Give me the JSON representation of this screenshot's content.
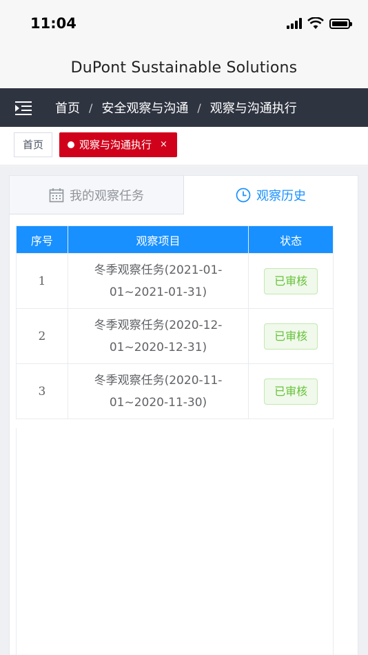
{
  "status_bar": {
    "time": "11:04"
  },
  "app": {
    "title": "DuPont Sustainable Solutions"
  },
  "breadcrumb": {
    "items": [
      "首页",
      "安全观察与沟通",
      "观察与沟通执行"
    ],
    "separator": "/"
  },
  "tags": {
    "home": "首页",
    "active": "观察与沟通执行",
    "close": "×"
  },
  "tabs": [
    {
      "label": "我的观察任务",
      "icon": "calendar-icon",
      "active": false
    },
    {
      "label": "观察历史",
      "icon": "clock-icon",
      "active": true
    }
  ],
  "table": {
    "headers": [
      "序号",
      "观察项目",
      "状态"
    ],
    "rows": [
      {
        "index": "1",
        "item": "冬季观察任务(2021-01-01~2021-01-31)",
        "status": "已审核"
      },
      {
        "index": "2",
        "item": "冬季观察任务(2020-12-01~2020-12-31)",
        "status": "已审核"
      },
      {
        "index": "3",
        "item": "冬季观察任务(2020-11-01~2020-11-30)",
        "status": "已审核"
      }
    ]
  },
  "colors": {
    "nav_bg": "#2f3441",
    "accent": "#1890ff",
    "tag_active": "#d0021b",
    "status_green": "#67c23a"
  }
}
